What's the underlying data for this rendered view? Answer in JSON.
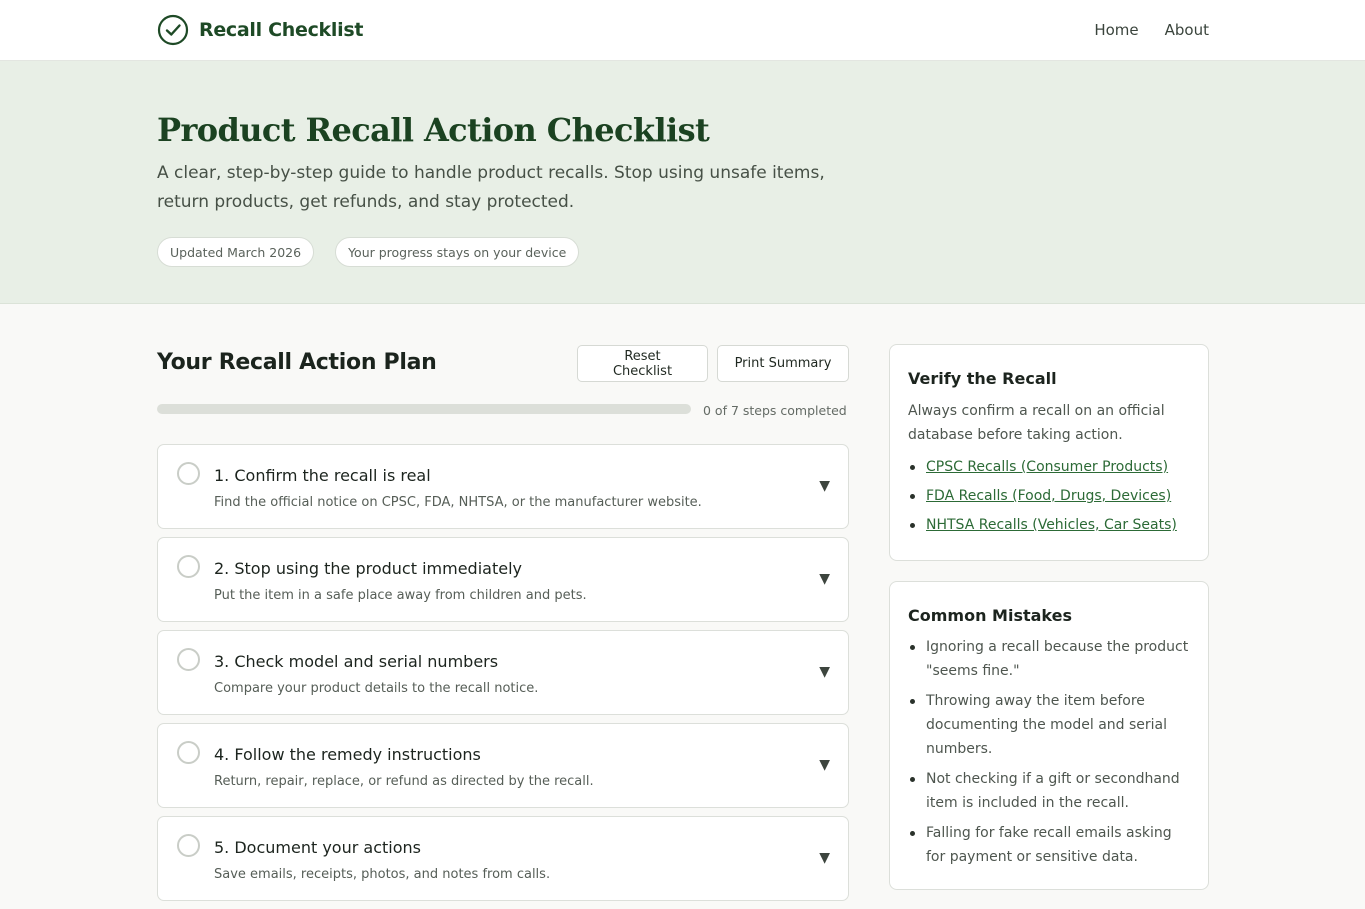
{
  "header": {
    "brand": "Recall Checklist",
    "nav": [
      "Home",
      "About"
    ]
  },
  "hero": {
    "title": "Product Recall Action Checklist",
    "subtitle": "A clear, step-by-step guide to handle product recalls. Stop using unsafe items, return products, get refunds, and stay protected.",
    "pills": [
      "Updated March 2026",
      "Your progress stays on your device"
    ]
  },
  "plan": {
    "title": "Your Recall Action Plan",
    "reset_label": "Reset Checklist",
    "print_label": "Print Summary",
    "progress_text": "0 of 7 steps completed",
    "progress_fraction": 0,
    "steps": [
      {
        "title": "1. Confirm the recall is real",
        "desc": "Find the official notice on CPSC, FDA, NHTSA, or the manufacturer website."
      },
      {
        "title": "2. Stop using the product immediately",
        "desc": "Put the item in a safe place away from children and pets."
      },
      {
        "title": "3. Check model and serial numbers",
        "desc": "Compare your product details to the recall notice."
      },
      {
        "title": "4. Follow the remedy instructions",
        "desc": "Return, repair, replace, or refund as directed by the recall."
      },
      {
        "title": "5. Document your actions",
        "desc": "Save emails, receipts, photos, and notes from calls."
      }
    ],
    "chevron": "▼"
  },
  "verify": {
    "title": "Verify the Recall",
    "text": "Always confirm a recall on an official database before taking action.",
    "links": [
      "CPSC Recalls (Consumer Products)",
      "FDA Recalls (Food, Drugs, Devices)",
      "NHTSA Recalls (Vehicles, Car Seats)"
    ]
  },
  "mistakes": {
    "title": "Common Mistakes",
    "items": [
      "Ignoring a recall because the product \"seems fine.\"",
      "Throwing away the item before documenting the model and serial numbers.",
      "Not checking if a gift or secondhand item is included in the recall.",
      "Falling for fake recall emails asking for payment or sensitive data."
    ]
  },
  "colors": {
    "brand": "#1e4a26",
    "hero_bg": "#e8efe6",
    "link": "#2c6a36"
  }
}
